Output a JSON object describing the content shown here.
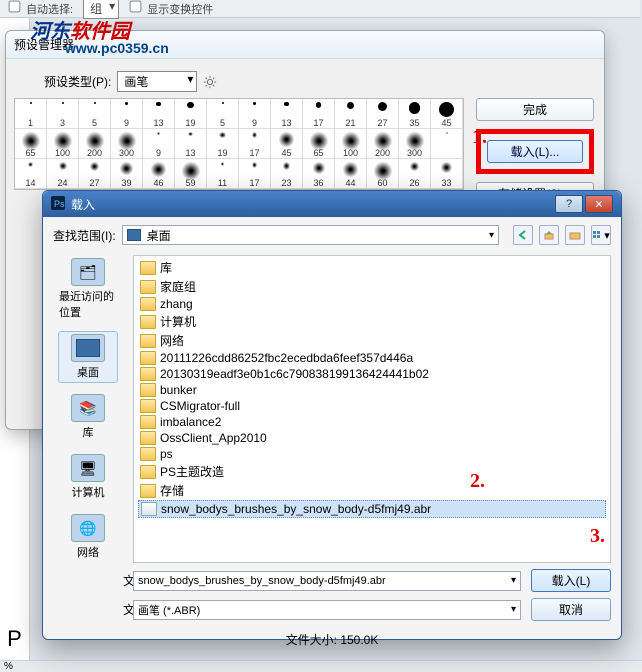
{
  "app_top": {
    "autoselect": "自动选择:",
    "group": "组",
    "show_transform": "显示变换控件"
  },
  "watermark": {
    "main_a": "河东",
    "main_b": "软件园",
    "sub": "www.pc0359.cn"
  },
  "outer": {
    "title": "预设管理器",
    "preset_label": "预设类型(P):",
    "preset_value": "画笔",
    "buttons": {
      "done": "完成",
      "load": "载入(L)...",
      "save": "存储设置(S)..."
    },
    "rows": [
      [
        1,
        3,
        5,
        9,
        13,
        19,
        5,
        9,
        13,
        17,
        21,
        27,
        35,
        45
      ],
      [
        65,
        100,
        200,
        300,
        9,
        13,
        19,
        17,
        45,
        65,
        100,
        200,
        300,
        ""
      ],
      [
        14,
        24,
        27,
        39,
        46,
        59,
        11,
        17,
        23,
        36,
        44,
        60,
        26,
        33
      ]
    ]
  },
  "annotations": {
    "n1": "1.",
    "n2": "2.",
    "n3": "3."
  },
  "dialog": {
    "title": "载入",
    "lookup_label": "查找范围(I):",
    "lookup_value": "桌面",
    "places": [
      {
        "id": "recent",
        "label": "最近访问的位置"
      },
      {
        "id": "desktop",
        "label": "桌面"
      },
      {
        "id": "libraries",
        "label": "库"
      },
      {
        "id": "computer",
        "label": "计算机"
      },
      {
        "id": "network",
        "label": "网络"
      }
    ],
    "files": [
      "库",
      "家庭组",
      "zhang",
      "计算机",
      "网络",
      "20111226cdd86252fbc2ecedbda6feef357d446a",
      "20130319eadf3e0b1c6c790838199136424441b02",
      "bunker",
      "CSMigrator-full",
      "imbalance2",
      "OssClient_App2010",
      "ps",
      "PS主题改造",
      "存储",
      "snow_bodys_brushes_by_snow_body-d5fmj49.abr"
    ],
    "selected_index": 14,
    "filename_label": "文件名(N):",
    "filename_value": "snow_bodys_brushes_by_snow_body-d5fmj49.abr",
    "filetype_label": "文件类型(T):",
    "filetype_value": "画笔 (*.ABR)",
    "load_btn": "载入(L)",
    "cancel_btn": "取消",
    "filesize_label": "文件大小:",
    "filesize_value": "150.0K"
  },
  "left_edge_char": "P",
  "bottom_pct": "%"
}
